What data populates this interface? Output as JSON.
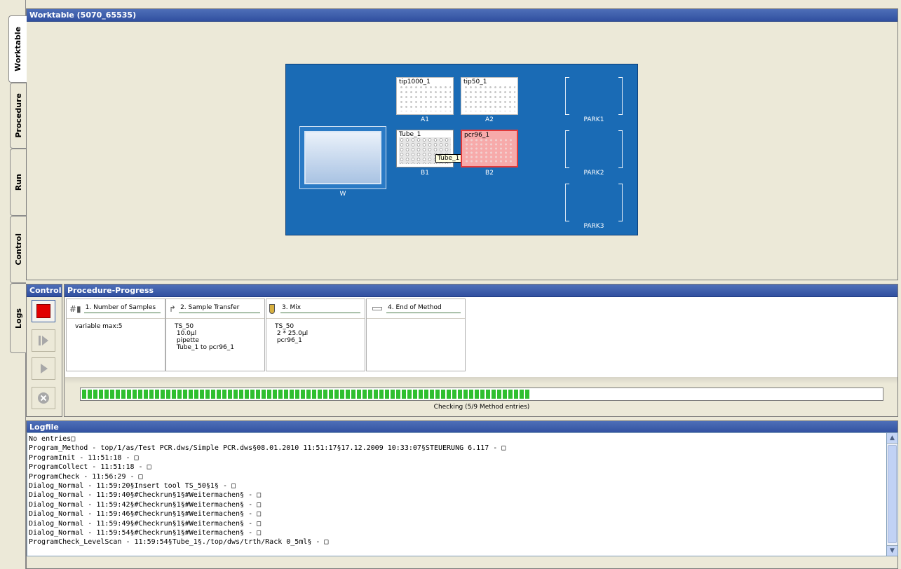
{
  "tabs": [
    "Worktable",
    "Procedure",
    "Run",
    "Control",
    "Logs"
  ],
  "worktable": {
    "title": "Worktable (5070_65535)",
    "positions": {
      "w": "W",
      "a1": "A1",
      "a2": "A2",
      "b1": "B1",
      "b2": "B2",
      "park1": "PARK1",
      "park2": "PARK2",
      "park3": "PARK3"
    },
    "plates": {
      "tip1000": "tip1000_1",
      "tip50": "tip50_1",
      "tube": "Tube_1",
      "pcr96": "pcr96_1"
    },
    "tooltip": "Tube_1"
  },
  "control": {
    "title": "Control"
  },
  "progress": {
    "title": "Procedure-Progress",
    "steps": [
      {
        "label": "1. Number of Samples",
        "body": "variable max:5"
      },
      {
        "label": "2. Sample Transfer",
        "body": "TS_50\n 10.0µl\n pipette\n Tube_1 to pcr96_1"
      },
      {
        "label": "3. Mix",
        "body": "TS_50\n 2 * 25.0µl\n pcr96_1"
      },
      {
        "label": "4. End of Method",
        "body": ""
      }
    ],
    "bar_fraction": 0.56,
    "status": "Checking (5/9 Method entries)"
  },
  "logfile": {
    "title": "Logfile",
    "lines": [
      "No entries□",
      "Program_Method - top/1/as/Test PCR.dws/Simple PCR.dws§08.01.2010 11:51:17§17.12.2009 10:33:07§STEUERUNG 6.117 - □",
      "ProgramInit - 11:51:18 - □",
      "ProgramCollect - 11:51:18 - □",
      "ProgramCheck - 11:56:29 - □",
      "Dialog_Normal - 11:59:20§Insert tool TS_50§1§ - □",
      "Dialog_Normal - 11:59:40§#Checkrun§1§#Weitermachen§ - □",
      "Dialog_Normal - 11:59:42§#Checkrun§1§#Weitermachen§ - □",
      "Dialog_Normal - 11:59:46§#Checkrun§1§#Weitermachen§ - □",
      "Dialog_Normal - 11:59:49§#Checkrun§1§#Weitermachen§ - □",
      "Dialog_Normal - 11:59:54§#Checkrun§1§#Weitermachen§ - □",
      "ProgramCheck_LevelScan - 11:59:54§Tube_1§./top/dws/trth/Rack 0_5ml§ - □"
    ]
  }
}
